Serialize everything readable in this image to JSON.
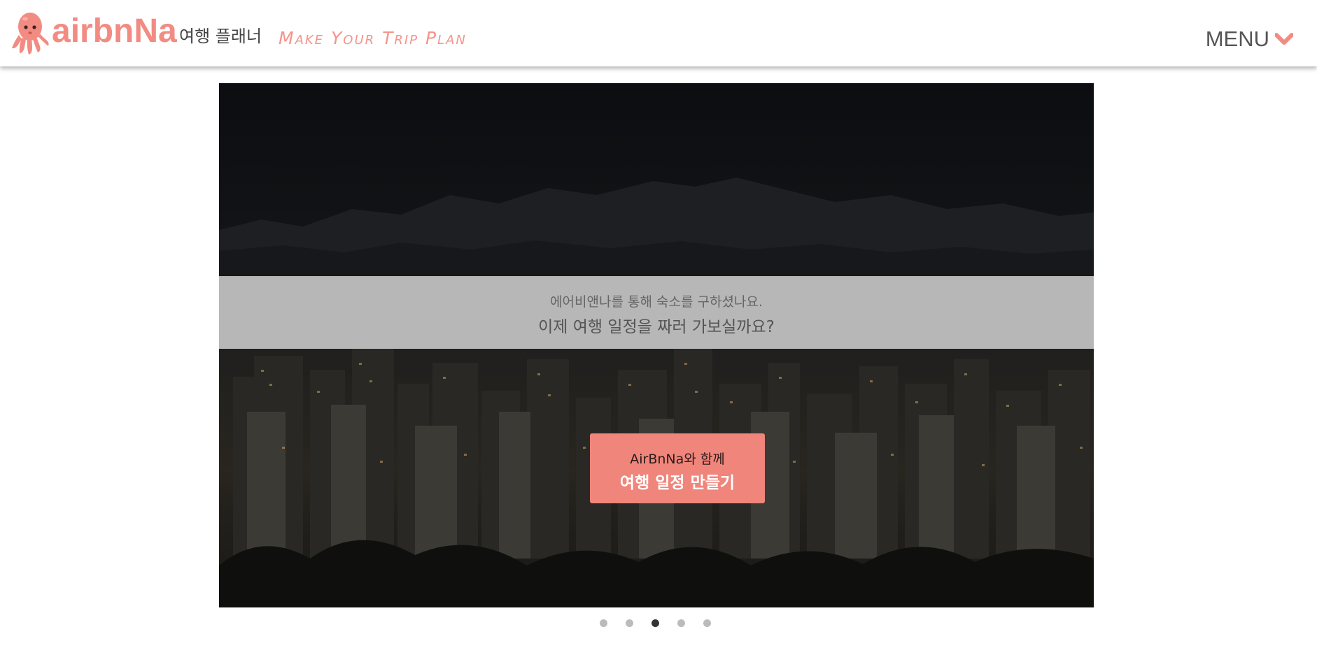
{
  "header": {
    "brand": "airbnNa",
    "subtitle": "여행 플래너",
    "tagline": "Make Your Trip Plan",
    "menu_label": "MENU",
    "accent_color": "#f28b82"
  },
  "icons": {
    "logo": "octopus-icon",
    "menu_chevron": "chevron-down-icon"
  },
  "hero": {
    "caption_line1": "에어비앤나를 통해 숙소를 구하셨나요.",
    "caption_line2": "이제 여행 일정을 짜러 가보실까요?",
    "cta_line1": "AirBnNa와 함께",
    "cta_line2": "여행 일정 만들기",
    "cta_color": "#f0857b"
  },
  "carousel": {
    "slide_count": 5,
    "active_slide": 3
  }
}
